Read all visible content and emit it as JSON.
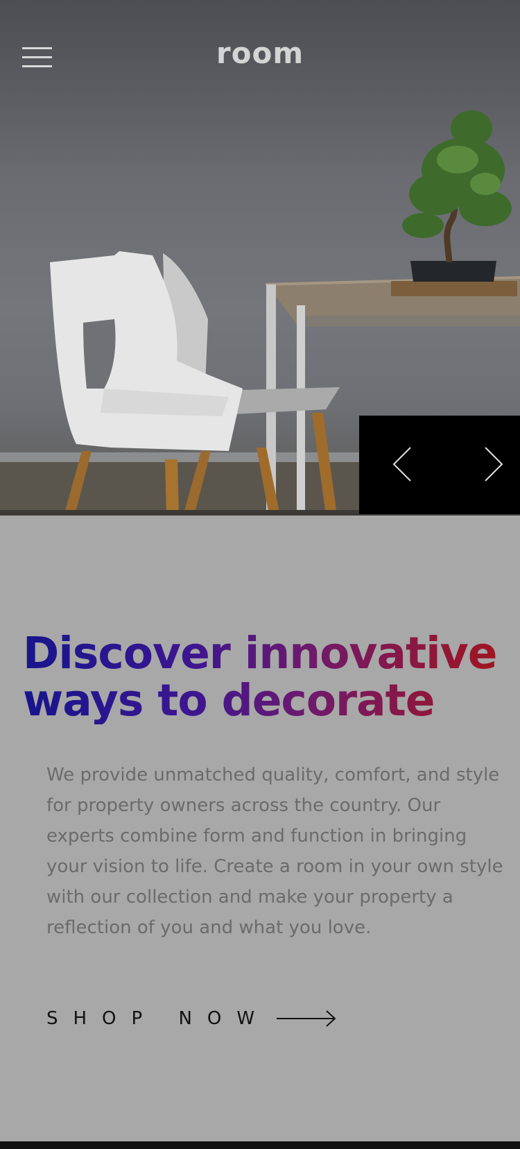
{
  "header": {
    "logo": "room",
    "menu_icon": "hamburger-icon"
  },
  "hero": {
    "image": "white chair, table with bonsai tree",
    "controls": {
      "prev_icon": "chevron-left-icon",
      "next_icon": "chevron-right-icon"
    }
  },
  "main": {
    "headline": "Discover innovative ways to decorate",
    "description": "We provide unmatched quality, comfort, and style for property owners across the country. Our experts combine form and function in bringing your vision to life. Create a room in your own style with our collection and make your property a reflection of you and what you love.",
    "cta_label": "SHOP NOW",
    "cta_icon": "arrow-right-icon"
  },
  "colors": {
    "headline_gradient_start": "#17158c",
    "headline_gradient_end": "#a3151c",
    "background": "#a8a8a8",
    "slider_controls_bg": "#000000"
  }
}
